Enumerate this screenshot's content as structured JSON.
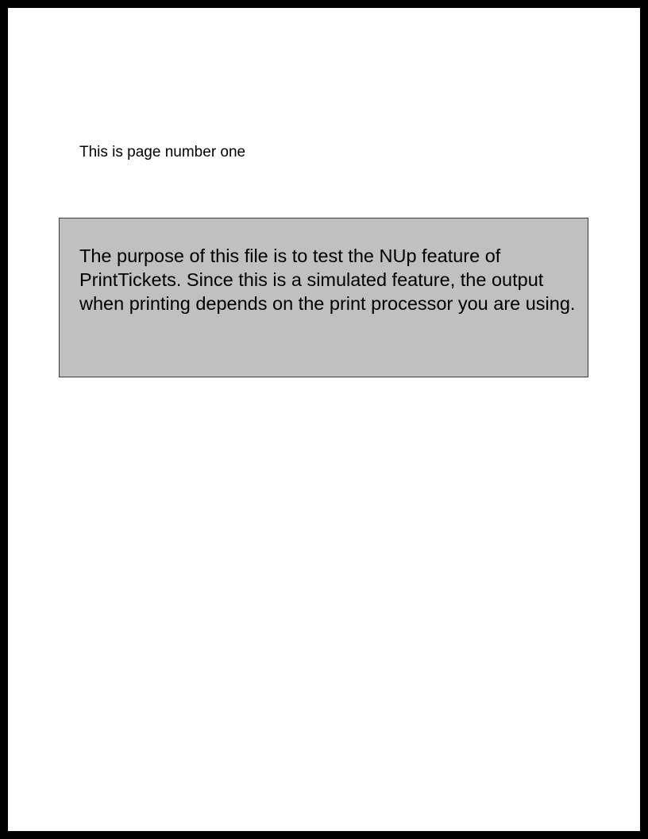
{
  "document": {
    "page_label": "This is page number one",
    "note": "The purpose of this file is to test the NUp feature of PrintTickets. Since this is a simulated feature, the output when printing depends on the print processor you are using."
  },
  "colors": {
    "frame": "#000000",
    "page_background": "#ffffff",
    "note_background": "#c0c0c0",
    "note_border": "#3a3a3a"
  }
}
